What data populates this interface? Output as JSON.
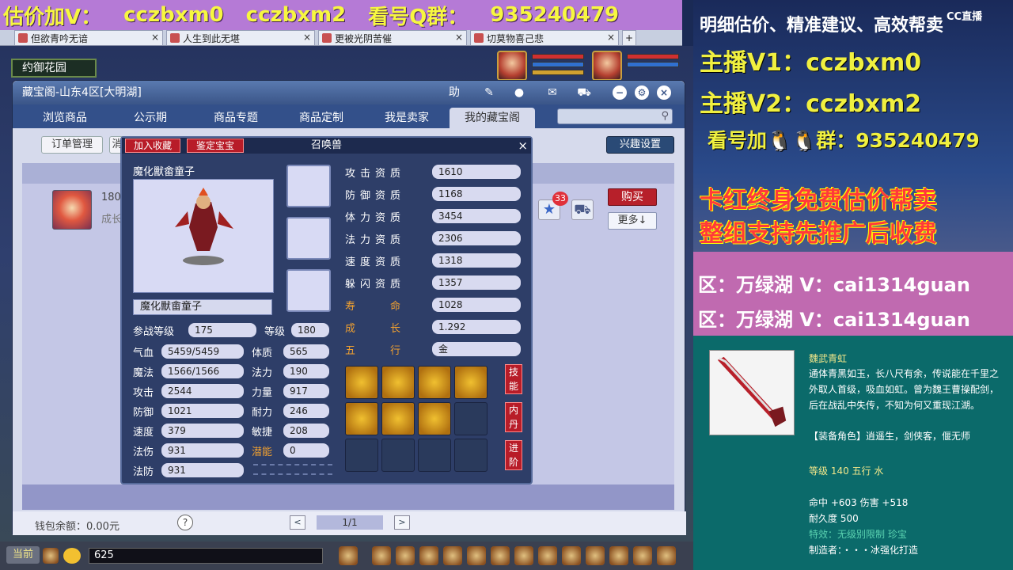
{
  "banner": {
    "seg1": "估价加V：",
    "seg2": "cczbxm0",
    "seg3": "cczbxm2",
    "seg4": "看号Q群：",
    "seg5": "935240479"
  },
  "browser_tabs": [
    {
      "label": "但欲青吟无谙"
    },
    {
      "label": "人生到此无堪"
    },
    {
      "label": "更被光阴苦催"
    },
    {
      "label": "切莫物喜己悲"
    }
  ],
  "tab_add": "+",
  "tab_close": "×",
  "scene_sign": "约御花园",
  "window": {
    "title": "藏宝阁-山东4区[大明湖]",
    "help_label": "助",
    "nav_tabs": [
      {
        "label": "浏览商品"
      },
      {
        "label": "公示期"
      },
      {
        "label": "商品专题"
      },
      {
        "label": "商品定制"
      },
      {
        "label": "我是卖家"
      },
      {
        "label": "我的藏宝阁"
      }
    ],
    "search_placeholder": "",
    "order_mgmt": "订单管理",
    "sub_trunc": "消",
    "hobby_settings": "兴趣设置",
    "list_item": {
      "level_text": "180",
      "sub_text": "成长",
      "fav_badge": "33",
      "buy_label": "购买",
      "more_label": "更多↓"
    },
    "footer": {
      "wallet": "钱包余额：0.00元",
      "help": "?",
      "page": "1/1",
      "prev": "<",
      "next": ">"
    }
  },
  "pet": {
    "dialog_title": "召唤兽",
    "add_fav": "加入收藏",
    "appraise": "鉴定宝宝",
    "name_header": "魔化獸畬童子",
    "name_field": "魔化獸畬童子",
    "close": "×",
    "battle_level_label": "参战等级",
    "battle_level": "175",
    "level_label": "等级",
    "level": "180",
    "stats": [
      {
        "label": "气血",
        "value": "5459/5459"
      },
      {
        "label": "魔法",
        "value": "1566/1566"
      },
      {
        "label": "攻击",
        "value": "2544"
      },
      {
        "label": "防御",
        "value": "1021"
      },
      {
        "label": "速度",
        "value": "379"
      },
      {
        "label": "法伤",
        "value": "931"
      },
      {
        "label": "法防",
        "value": "931"
      }
    ],
    "attrs": [
      {
        "label": "体质",
        "value": "565"
      },
      {
        "label": "法力",
        "value": "190"
      },
      {
        "label": "力量",
        "value": "917"
      },
      {
        "label": "耐力",
        "value": "246"
      },
      {
        "label": "敏捷",
        "value": "208"
      },
      {
        "label": "潜能",
        "value": "0"
      }
    ],
    "qualities": [
      {
        "label": "攻击资质",
        "value": "1610"
      },
      {
        "label": "防御资质",
        "value": "1168"
      },
      {
        "label": "体力资质",
        "value": "3454"
      },
      {
        "label": "法力资质",
        "value": "2306"
      },
      {
        "label": "速度资质",
        "value": "1318"
      },
      {
        "label": "躲闪资质",
        "value": "1357"
      },
      {
        "label": "寿命",
        "value": "1028"
      },
      {
        "label": "成长",
        "value": "1.292"
      },
      {
        "label": "五行",
        "value": "金"
      }
    ],
    "side_buttons": [
      "技能",
      "内丹",
      "进阶"
    ],
    "colors": {
      "accent_red": "#b81c28",
      "quality_orange": "#f0a030",
      "potential_orange": "#f0a030"
    }
  },
  "gamebar": {
    "current": "当前",
    "input_value": "625"
  },
  "stream": {
    "cc_logo": "CC直播",
    "line1": "明细估价、精准建议、高效帮卖",
    "line2": "主播V1：cczbxm0",
    "line3": "主播V2：cczbxm2",
    "line4": "看号加🐧🐧群：935240479",
    "line5": "卡红终身免费估价帮卖",
    "line6": "整组支持先推广后收费",
    "pink1": "区：万绿湖 V：cai1314guan",
    "pink2": "区：万绿湖 V：cai1314guan",
    "weapon": {
      "name": "魏武青虹",
      "desc": "通体青黑如玉，长八尺有余，传说能在千里之外取人首级，吸血如虹。曾为魏王曹操配剑，后在战乱中失传，不知为何又重现江湖。",
      "role": "【装备角色】逍遥生，剑侠客，偃无师",
      "level": "等级 140 五行 水",
      "hit": "命中 +603 伤害 +518",
      "durability": "耐久度 500",
      "special": "特效：无级别限制 珍宝",
      "maker": "制造者：・・・冰强化打造"
    }
  }
}
